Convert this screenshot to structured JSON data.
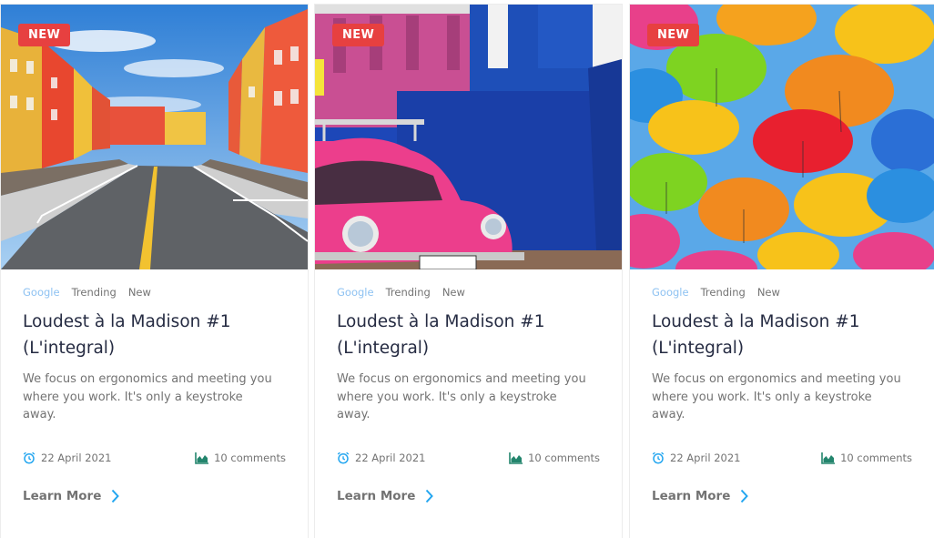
{
  "colors": {
    "badge": "#e74040",
    "tag_accent": "#8ec2f2",
    "icon_blue": "#23a6f0",
    "icon_green": "#23856d",
    "text_dark": "#252b42",
    "text_muted": "#737373"
  },
  "cards": [
    {
      "badge": "NEW",
      "image_icon": "street-photo",
      "tags": [
        "Google",
        "Trending",
        "New"
      ],
      "title_line1": "Loudest à la Madison #1",
      "title_line2": "(L'integral)",
      "description": "We focus on ergonomics and meeting you where you work. It's only a keystroke away.",
      "date": "22 April 2021",
      "comments": "10 comments",
      "cta": "Learn More"
    },
    {
      "badge": "NEW",
      "image_icon": "pink-beetle-photo",
      "tags": [
        "Google",
        "Trending",
        "New"
      ],
      "title_line1": "Loudest à la Madison #1",
      "title_line2": "(L'integral)",
      "description": "We focus on ergonomics and meeting you where you work. It's only a keystroke away.",
      "date": "22 April 2021",
      "comments": "10 comments",
      "cta": "Learn More"
    },
    {
      "badge": "NEW",
      "image_icon": "umbrellas-photo",
      "tags": [
        "Google",
        "Trending",
        "New"
      ],
      "title_line1": "Loudest à la Madison #1",
      "title_line2": "(L'integral)",
      "description": "We focus on ergonomics and meeting you where you work. It's only a keystroke away.",
      "date": "22 April 2021",
      "comments": "10 comments",
      "cta": "Learn More"
    }
  ]
}
